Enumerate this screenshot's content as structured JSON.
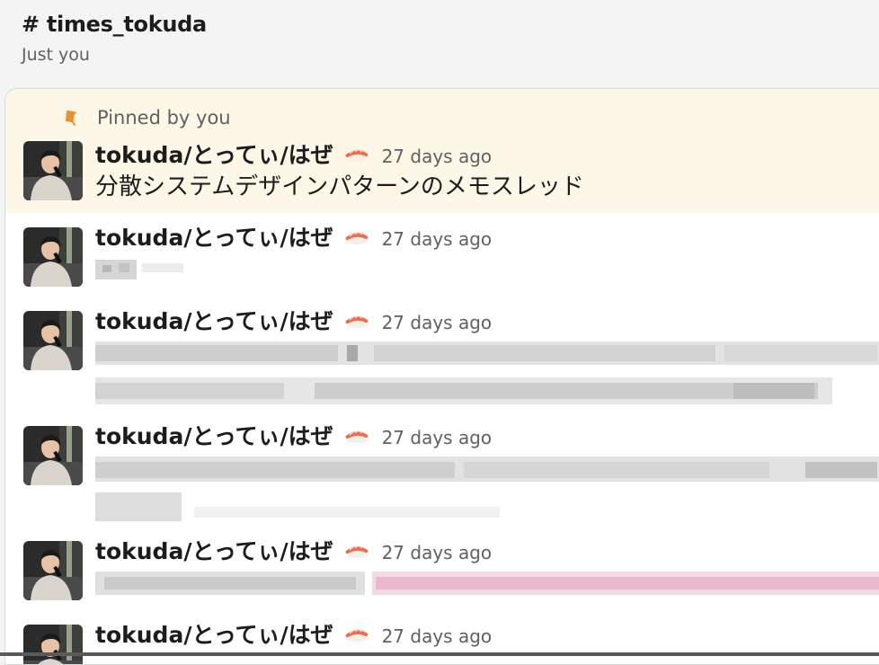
{
  "channel": {
    "title": "# times_tokuda",
    "subtitle": "Just you"
  },
  "pinned": {
    "label": "Pinned by you"
  },
  "messages": [
    {
      "author": "tokuda/とってぃ/はぜ",
      "timestamp": "27 days ago",
      "text": "分散システムデザインパターンのメモスレッド",
      "pinned": true
    },
    {
      "author": "tokuda/とってぃ/はぜ",
      "timestamp": "27 days ago",
      "text": ""
    },
    {
      "author": "tokuda/とってぃ/はぜ",
      "timestamp": "27 days ago",
      "text": ""
    },
    {
      "author": "tokuda/とってぃ/はぜ",
      "timestamp": "27 days ago",
      "text": ""
    },
    {
      "author": "tokuda/とってぃ/はぜ",
      "timestamp": "27 days ago",
      "text": ""
    },
    {
      "author": "tokuda/とってぃ/はぜ",
      "timestamp": "27 days ago",
      "text": ""
    }
  ],
  "icons": {
    "pin": "pushpin-icon",
    "emoji": "sushi-icon",
    "avatar": "user-avatar"
  },
  "colors": {
    "pinned_bg": "#fdf7e7",
    "pin": "#e8912d",
    "muted": "#616061",
    "text": "#1d1c1d"
  }
}
